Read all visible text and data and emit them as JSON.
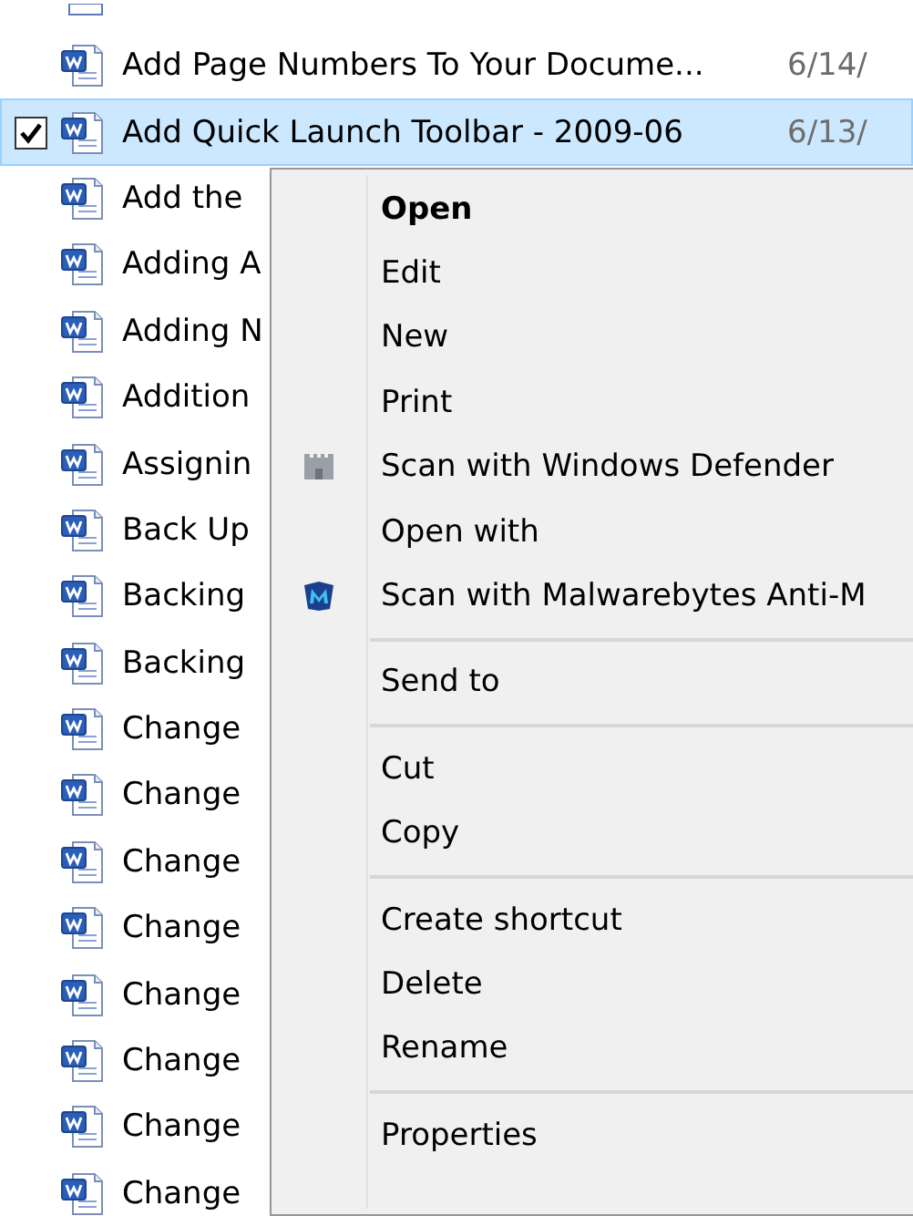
{
  "files": [
    {
      "name": "Add Page Numbers To Your Docume...",
      "date": "6/14/",
      "selected": false
    },
    {
      "name": "Add Quick Launch Toolbar - 2009-06",
      "date": "6/13/",
      "selected": true
    },
    {
      "name": "Add the",
      "selected": false
    },
    {
      "name": "Adding A",
      "selected": false
    },
    {
      "name": "Adding N",
      "selected": false
    },
    {
      "name": "Addition",
      "selected": false
    },
    {
      "name": "Assignin",
      "selected": false
    },
    {
      "name": "Back Up",
      "selected": false
    },
    {
      "name": "Backing",
      "selected": false
    },
    {
      "name": "Backing",
      "selected": false
    },
    {
      "name": "Change",
      "selected": false
    },
    {
      "name": "Change",
      "selected": false
    },
    {
      "name": "Change",
      "selected": false
    },
    {
      "name": "Change",
      "selected": false
    },
    {
      "name": "Change",
      "selected": false
    },
    {
      "name": "Change",
      "selected": false
    },
    {
      "name": "Change",
      "selected": false
    },
    {
      "name": "Change",
      "selected": false
    }
  ],
  "context_menu": [
    {
      "kind": "item",
      "label": "Open",
      "default": true
    },
    {
      "kind": "item",
      "label": "Edit",
      "default": false
    },
    {
      "kind": "item",
      "label": "New",
      "default": false
    },
    {
      "kind": "item",
      "label": "Print",
      "default": false
    },
    {
      "kind": "item",
      "label": "Scan with Windows Defender",
      "default": false
    },
    {
      "kind": "item",
      "label": "Open with",
      "default": false
    },
    {
      "kind": "item",
      "label": "Scan with Malwarebytes Anti-M",
      "default": false
    },
    {
      "kind": "separator"
    },
    {
      "kind": "item",
      "label": "Send to",
      "default": false
    },
    {
      "kind": "separator"
    },
    {
      "kind": "item",
      "label": "Cut",
      "default": false
    },
    {
      "kind": "item",
      "label": "Copy",
      "default": false
    },
    {
      "kind": "separator"
    },
    {
      "kind": "item",
      "label": "Create shortcut",
      "default": false
    },
    {
      "kind": "item",
      "label": "Delete",
      "default": false
    },
    {
      "kind": "item",
      "label": "Rename",
      "default": false
    },
    {
      "kind": "separator"
    },
    {
      "kind": "item",
      "label": "Properties",
      "default": false
    }
  ]
}
